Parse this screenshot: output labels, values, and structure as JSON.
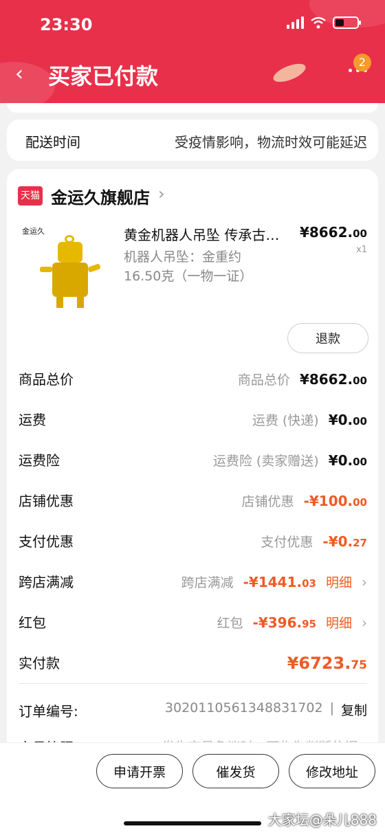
{
  "status_bar": {
    "time": "23:30"
  },
  "header": {
    "title": "买家已付款",
    "back_glyph": "‹",
    "more_badge": "2",
    "accent": "#e8304a"
  },
  "delivery": {
    "label": "配送时间",
    "value": "受疫情影响，物流时效可能延迟"
  },
  "shop": {
    "logo_text": "天猫",
    "name": "金运久旗舰店",
    "chevron": "›"
  },
  "product": {
    "brand_text": "金运久",
    "name": "黄金机器人吊坠 传承古…",
    "spec": "机器人吊坠：金重约16.50克（一物一证）",
    "price_int": "¥8662.",
    "price_dec": "00",
    "qty": "x1",
    "refund_label": "退款"
  },
  "fees": [
    {
      "label": "商品总价",
      "sub": "商品总价",
      "amount_int": "¥8662.",
      "amount_dec": "00",
      "red": false,
      "detail": ""
    },
    {
      "label": "运费",
      "sub": "运费 (快递)",
      "amount_int": "¥0.",
      "amount_dec": "00",
      "red": false,
      "detail": ""
    },
    {
      "label": "运费险",
      "sub": "运费险 (卖家赠送)",
      "amount_int": "¥0.",
      "amount_dec": "00",
      "red": false,
      "detail": ""
    },
    {
      "label": "店铺优惠",
      "sub": "店铺优惠",
      "amount_int": "-¥100.",
      "amount_dec": "00",
      "red": true,
      "detail": ""
    },
    {
      "label": "支付优惠",
      "sub": "支付优惠",
      "amount_int": "-¥0.",
      "amount_dec": "27",
      "red": true,
      "detail": ""
    },
    {
      "label": "跨店满减",
      "sub": "跨店满减",
      "amount_int": "-¥1441.",
      "amount_dec": "03",
      "red": true,
      "detail": "明细"
    },
    {
      "label": "红包",
      "sub": "红包",
      "amount_int": "-¥396.",
      "amount_dec": "95",
      "red": true,
      "detail": "明细"
    }
  ],
  "total": {
    "label": "实付款",
    "amount_int": "¥6723.",
    "amount_dec": "75"
  },
  "order": {
    "label": "订单编号:",
    "number": "3020110561348831702",
    "sep": "|",
    "copy_label": "复制"
  },
  "snapshot": {
    "label": "交易快照",
    "value": "发生交易争议时，可作为判断依据 ›"
  },
  "buttons": {
    "invoice": "申请开票",
    "urge": "催发货",
    "address": "修改地址"
  },
  "watermark": "大家坛@朵儿888"
}
